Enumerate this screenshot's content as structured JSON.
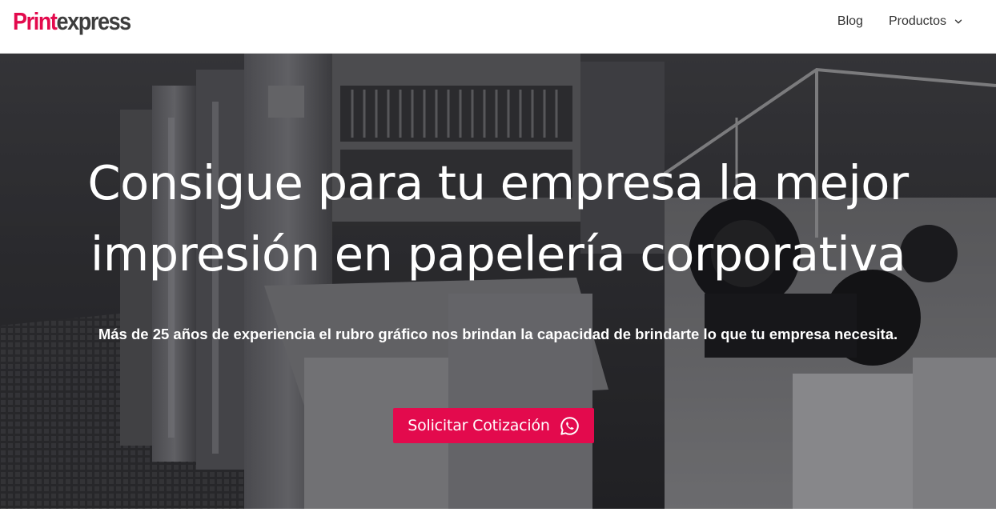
{
  "brand": {
    "logo_part1": "Print",
    "logo_part2": "express",
    "accent_color": "#e30a4d",
    "dark_color": "#3d3d3d"
  },
  "nav": {
    "items": [
      {
        "label": "Blog"
      },
      {
        "label": "Productos",
        "icon": "chevron-down-icon"
      }
    ]
  },
  "hero": {
    "background": "grayscale photo of an industrial offset printing press",
    "title": "Consigue para tu empresa la mejor impresión en papelería corporativa",
    "subtitle": "Más de 25 años de experiencia el rubro gráfico nos brindan la capacidad de brindarte lo que tu empresa necesita.",
    "cta": {
      "label": "Solicitar Cotización",
      "icon": "whatsapp-icon",
      "color": "#e30a4d"
    }
  }
}
